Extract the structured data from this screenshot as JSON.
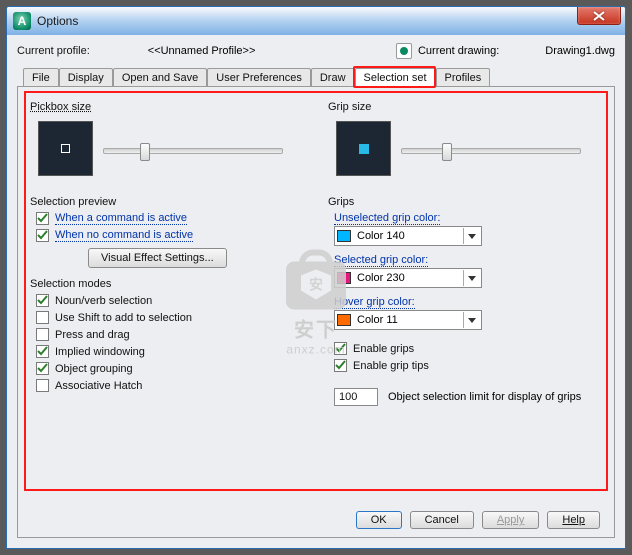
{
  "window": {
    "title": "Options"
  },
  "profile": {
    "label": "Current profile:",
    "value": "<<Unnamed Profile>>",
    "drawing_label": "Current drawing:",
    "drawing_value": "Drawing1.dwg"
  },
  "tabs": [
    {
      "label": "File"
    },
    {
      "label": "Display"
    },
    {
      "label": "Open and Save"
    },
    {
      "label": "User Preferences"
    },
    {
      "label": "Draw"
    },
    {
      "label": "Selection set"
    },
    {
      "label": "Profiles"
    }
  ],
  "active_tab_index": 5,
  "left": {
    "pickbox_size_label": "Pickbox size",
    "selection_preview_label": "Selection preview",
    "preview_checks": [
      {
        "label": "When a command is active",
        "checked": true,
        "link": true
      },
      {
        "label": "When no command is active",
        "checked": true,
        "link": true
      }
    ],
    "visual_effect_btn": "Visual Effect Settings...",
    "selection_modes_label": "Selection modes",
    "mode_checks": [
      {
        "label": "Noun/verb selection",
        "checked": true
      },
      {
        "label": "Use Shift to add to selection",
        "checked": false
      },
      {
        "label": "Press and drag",
        "checked": false
      },
      {
        "label": "Implied windowing",
        "checked": true
      },
      {
        "label": "Object grouping",
        "checked": true
      },
      {
        "label": "Associative Hatch",
        "checked": false
      }
    ]
  },
  "right": {
    "grip_size_label": "Grip size",
    "grips_label": "Grips",
    "unselected_label": "Unselected grip color:",
    "unselected_value": "Color 140",
    "unselected_swatch": "#00b7ff",
    "selected_label": "Selected grip color:",
    "selected_value": "Color 230",
    "selected_swatch": "#e6177e",
    "hover_label": "Hover grip color:",
    "hover_value": "Color 11",
    "hover_swatch": "#ff6a00",
    "enable_grips": {
      "label": "Enable grips",
      "checked": true
    },
    "enable_grip_tips": {
      "label": "Enable grip tips",
      "checked": true
    },
    "limit_value": "100",
    "limit_label": "Object selection limit for display of grips"
  },
  "buttons": {
    "ok": "OK",
    "cancel": "Cancel",
    "apply": "Apply",
    "help": "Help"
  },
  "watermark": {
    "line1": "安下",
    "line2": "anxz.com"
  }
}
